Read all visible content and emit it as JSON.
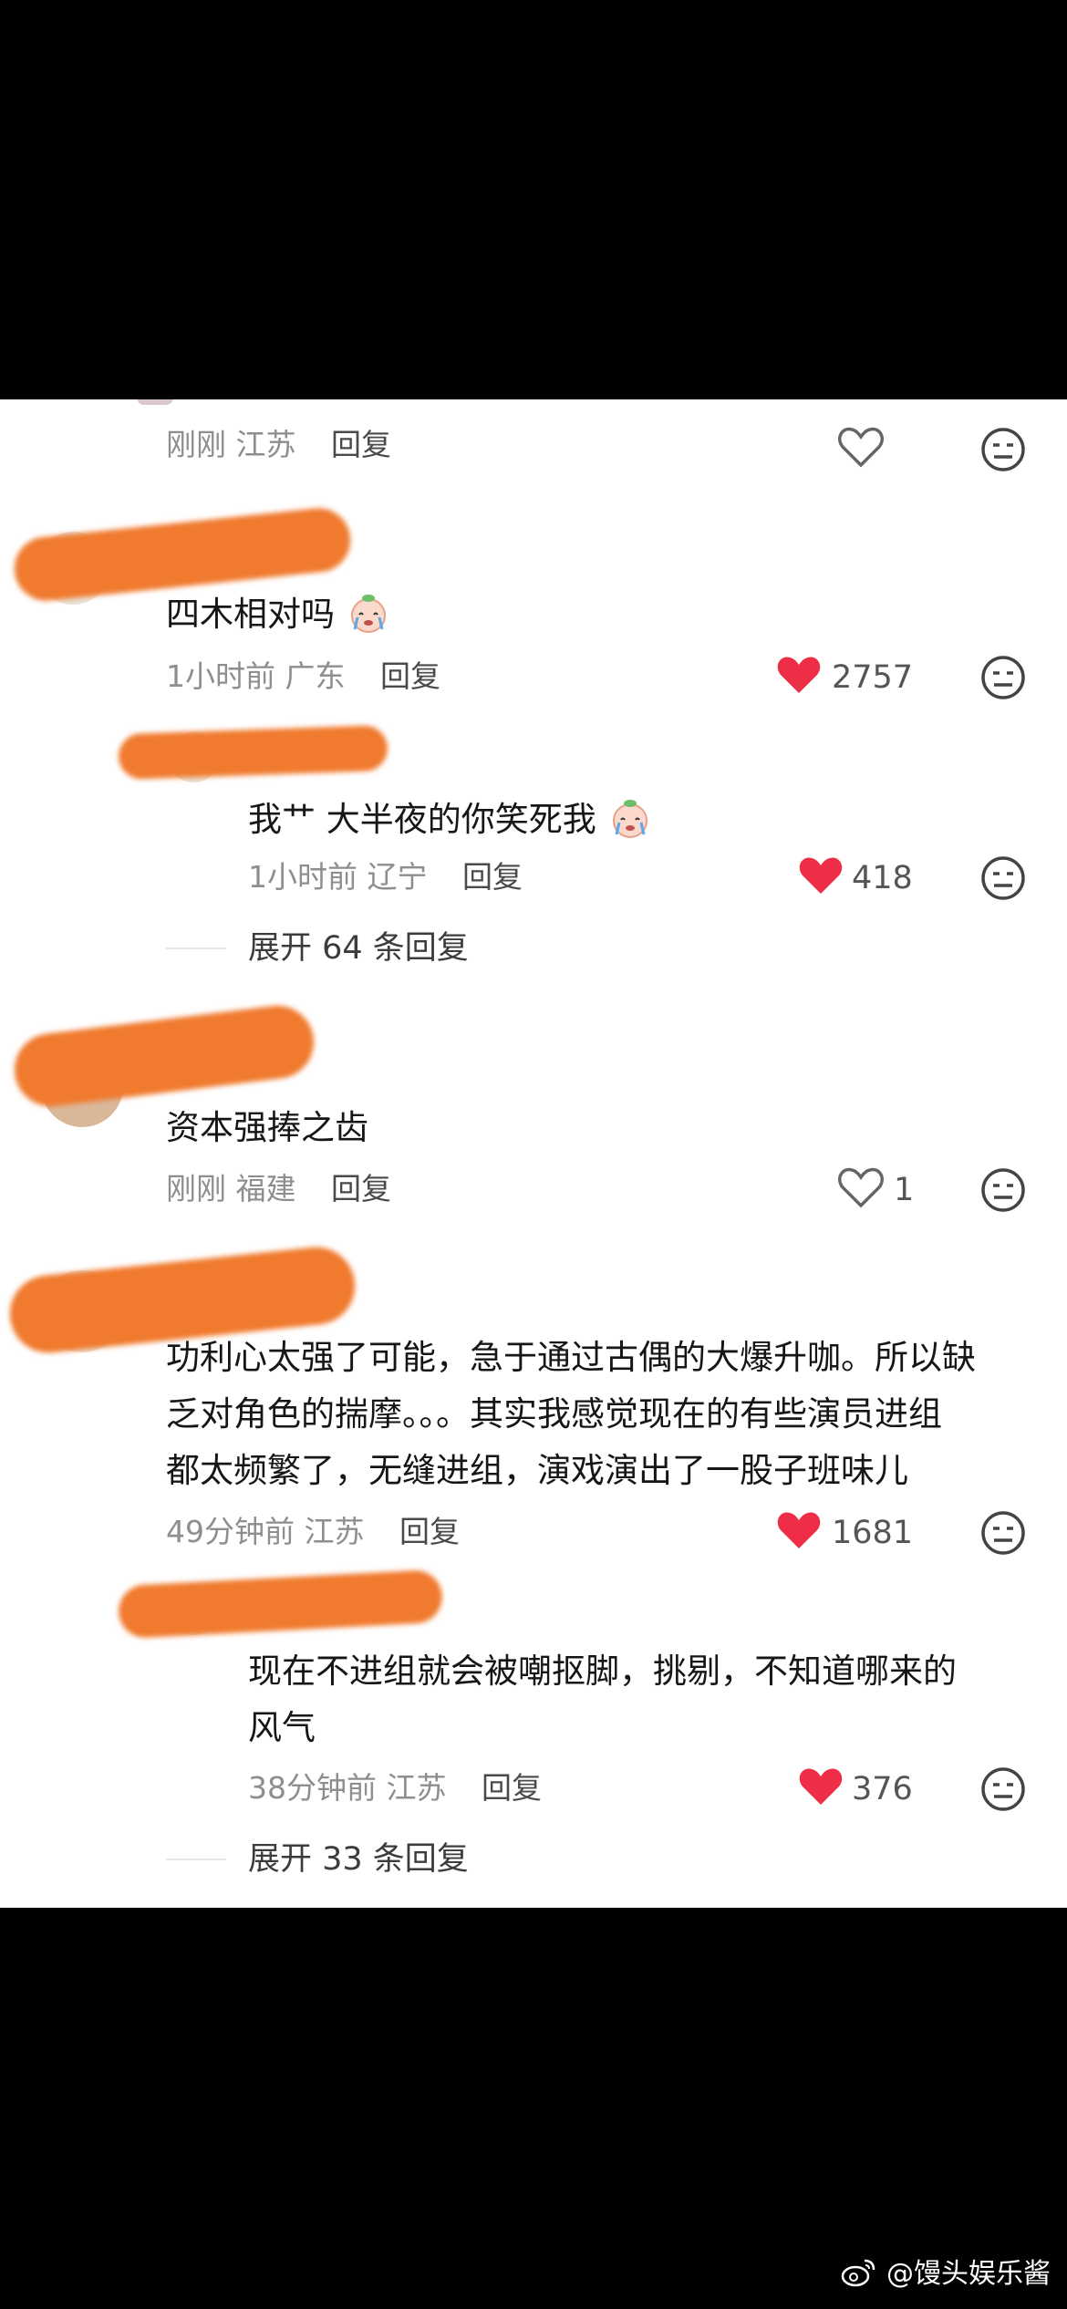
{
  "comments": [
    {
      "text": "",
      "time": "刚刚",
      "location": "江苏",
      "reply_label": "回复",
      "likes": ""
    },
    {
      "text": "四木相对吗",
      "emoji": "crying-peach-emoji",
      "time": "1小时前",
      "location": "广东",
      "reply_label": "回复",
      "likes": "2757",
      "liked": true,
      "sub": {
        "text": "我艹 大半夜的你笑死我",
        "emoji": "crying-peach-emoji",
        "time": "1小时前",
        "location": "辽宁",
        "reply_label": "回复",
        "likes": "418",
        "liked": true
      },
      "expand": "展开 64 条回复"
    },
    {
      "text": "资本强捧之齿",
      "time": "刚刚",
      "location": "福建",
      "reply_label": "回复",
      "likes": "1",
      "liked": false
    },
    {
      "text_lines": [
        "功利心太强了可能，急于通过古偶的大爆升咖。所以缺",
        "乏对角色的揣摩。。。其实我感觉现在的有些演员进组",
        "都太频繁了，无缝进组，演戏演出了一股子班味儿"
      ],
      "time": "49分钟前",
      "location": "江苏",
      "reply_label": "回复",
      "likes": "1681",
      "liked": true,
      "sub": {
        "text_lines": [
          "现在不进组就会被嘲抠脚，挑剔，不知道哪来的",
          "风气"
        ],
        "time": "38分钟前",
        "location": "江苏",
        "reply_label": "回复",
        "likes": "376",
        "liked": true
      },
      "expand": "展开 33 条回复"
    }
  ],
  "watermark": "@馒头娱乐酱",
  "colors": {
    "heart_liked": "#ee2e46",
    "redaction": "#f07a2e"
  }
}
